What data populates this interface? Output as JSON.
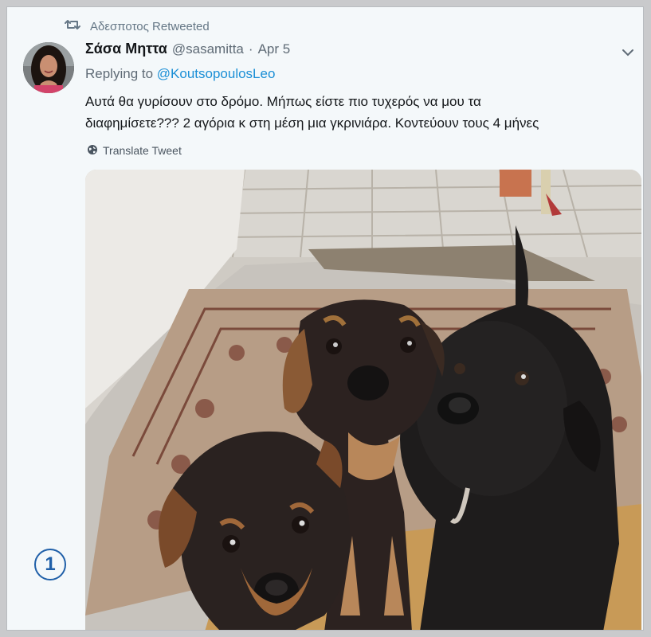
{
  "retweet": {
    "label": "Αδεσποτος Retweeted",
    "icon": "retweet-icon"
  },
  "author": {
    "display_name": "Σάσα Μηττα",
    "handle": "@sasamitta",
    "separator": "·",
    "date": "Apr 5"
  },
  "reply": {
    "prefix": "Replying to ",
    "mention": "@KoutsopoulosLeo"
  },
  "tweet": {
    "line1": "Αυτά θα γυρίσουν στο δρόμο. Μήπως είστε πιο τυχερός να μου τα",
    "line2": "διαφημίσετε??? 2 αγόρια κ στη μέση μια γκρινιάρα. Κοντεύουν τους 4 μήνες"
  },
  "translate": {
    "label": "Translate Tweet",
    "icon": "globe-icon"
  },
  "menu": {
    "icon": "chevron-down-icon"
  },
  "badge": {
    "number": "1"
  },
  "colors": {
    "link": "#1b8fd6",
    "muted": "#5f6b76",
    "badge": "#1f5fa8"
  }
}
